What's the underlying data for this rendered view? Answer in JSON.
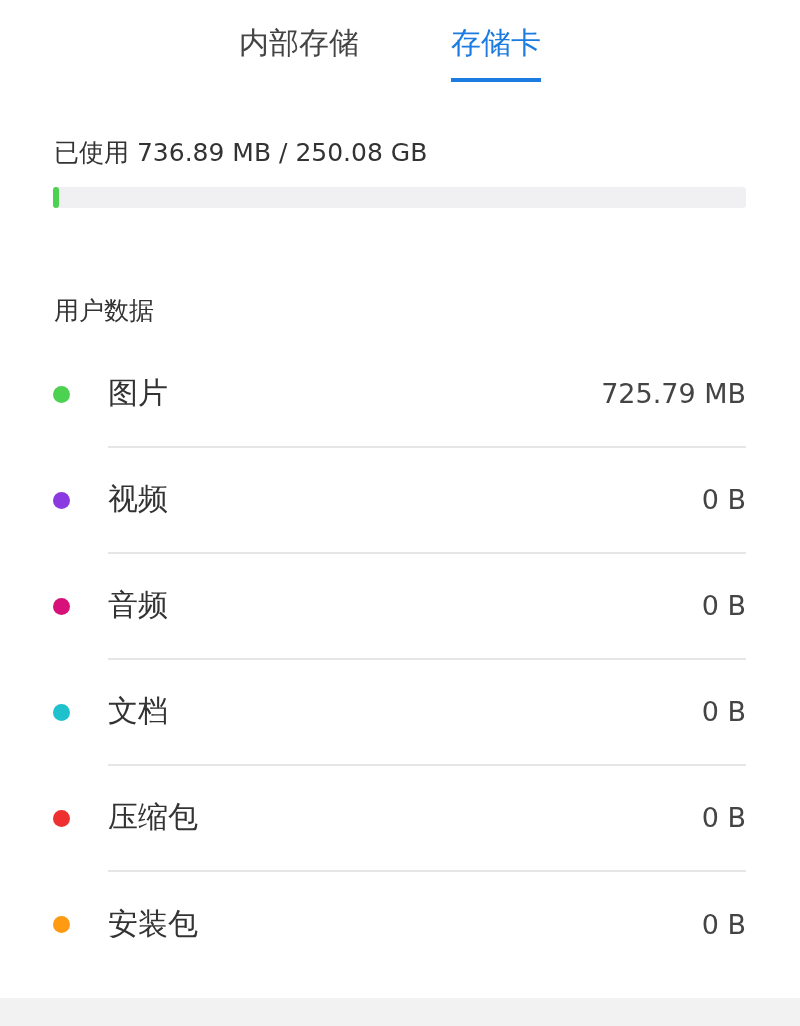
{
  "tabs": [
    {
      "label": "内部存储",
      "selected": false
    },
    {
      "label": "存储卡",
      "selected": true
    }
  ],
  "usage": {
    "text": "已使用 736.89 MB / 250.08 GB",
    "level": 0.003
  },
  "section_title": "用户数据",
  "categories": [
    {
      "name": "图片",
      "size": "725.79 MB",
      "color": "#4cd150"
    },
    {
      "name": "视频",
      "size": "0 B",
      "color": "#8a3ae0"
    },
    {
      "name": "音频",
      "size": "0 B",
      "color": "#d8117a"
    },
    {
      "name": "文档",
      "size": "0 B",
      "color": "#1fc1cc"
    },
    {
      "name": "压缩包",
      "size": "0 B",
      "color": "#ee3030"
    },
    {
      "name": "安装包",
      "size": "0 B",
      "color": "#ff9b12"
    }
  ]
}
